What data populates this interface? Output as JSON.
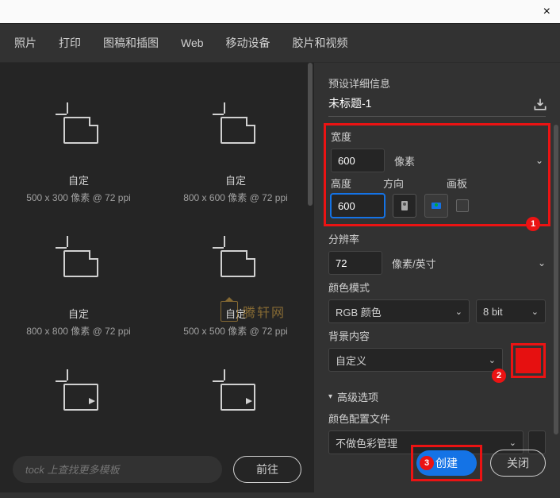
{
  "titlebar": {
    "close": "×"
  },
  "tabs": [
    "照片",
    "打印",
    "图稿和插图",
    "Web",
    "移动设备",
    "胶片和视频"
  ],
  "templates": [
    {
      "title": "自定",
      "sub": "500 x 300 像素 @ 72 ppi"
    },
    {
      "title": "自定",
      "sub": "800 x 600 像素 @ 72 ppi"
    },
    {
      "title": "自定",
      "sub": "800 x 800 像素 @ 72 ppi"
    },
    {
      "title": "自定",
      "sub": "500 x 500 像素 @ 72 ppi"
    },
    {
      "title": "",
      "sub": ""
    },
    {
      "title": "",
      "sub": ""
    }
  ],
  "search": {
    "placeholder": "tock 上查找更多模板",
    "go": "前往"
  },
  "panel": {
    "section": "预设详细信息",
    "docname": "未标题-1",
    "width_label": "宽度",
    "width": "600",
    "unit": "像素",
    "height_label": "高度",
    "height": "600",
    "orient_label": "方向",
    "artboard_label": "画板",
    "res_label": "分辨率",
    "res": "72",
    "res_unit": "像素/英寸",
    "colormode_label": "颜色模式",
    "colormode": "RGB 颜色",
    "bitdepth": "8 bit",
    "bg_label": "背景内容",
    "bg": "自定义",
    "bg_color": "#e61010",
    "adv": "高级选项",
    "profile_label": "颜色配置文件",
    "profile": "不做色彩管理",
    "create": "创建",
    "close": "关闭",
    "callouts": {
      "c1": "1",
      "c2": "2",
      "c3": "3"
    }
  },
  "watermark": "腾轩网"
}
